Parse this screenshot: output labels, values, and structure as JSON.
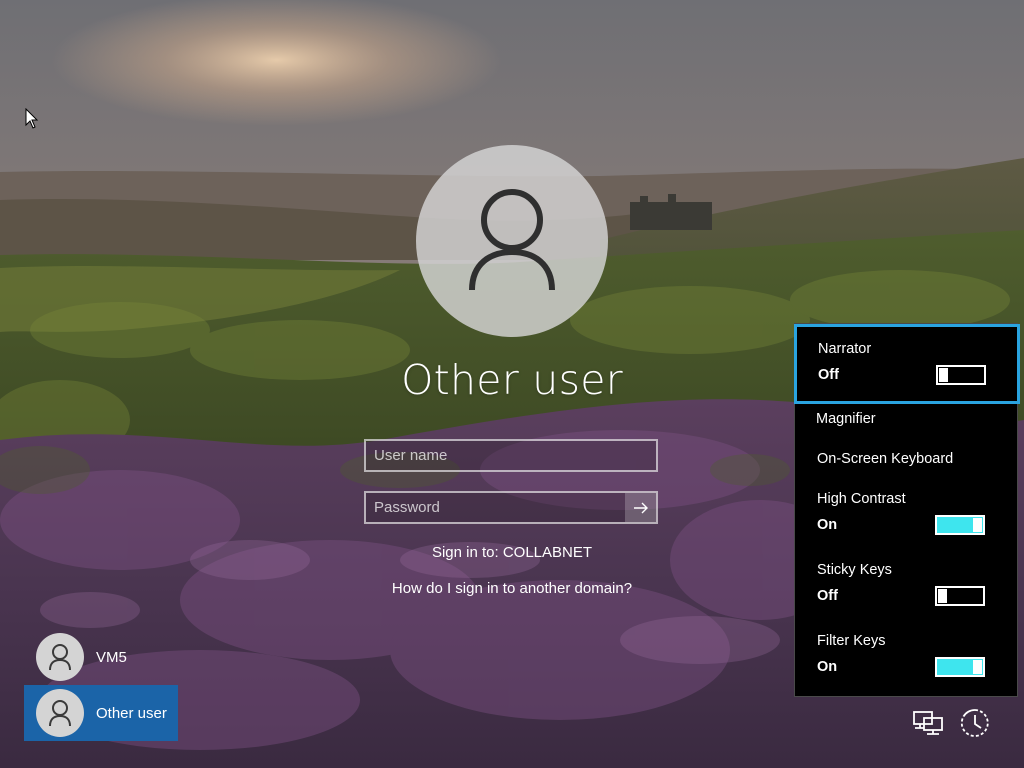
{
  "login": {
    "title": "Other user",
    "username_placeholder": "User name",
    "password_placeholder": "Password",
    "sign_in_to": "Sign in to: COLLABNET",
    "other_domain_link": "How do I sign in to another domain?"
  },
  "users": [
    {
      "name": "VM5",
      "selected": false
    },
    {
      "name": "Other user",
      "selected": true
    }
  ],
  "ease_of_access": {
    "items": [
      {
        "label": "Narrator",
        "state": "Off",
        "toggle": "off",
        "focused": true
      },
      {
        "label": "Magnifier"
      },
      {
        "label": "On-Screen Keyboard"
      },
      {
        "label": "High Contrast",
        "state": "On",
        "toggle": "on"
      },
      {
        "label": "Sticky Keys",
        "state": "Off",
        "toggle": "off"
      },
      {
        "label": "Filter Keys",
        "state": "On",
        "toggle": "on"
      }
    ]
  },
  "bottom_icons": [
    "network-icon",
    "ease-of-access-icon"
  ],
  "colors": {
    "selected_user": "#1b64a8",
    "focus_border": "#2aa4e0",
    "toggle_on": "#3ee5ee"
  }
}
